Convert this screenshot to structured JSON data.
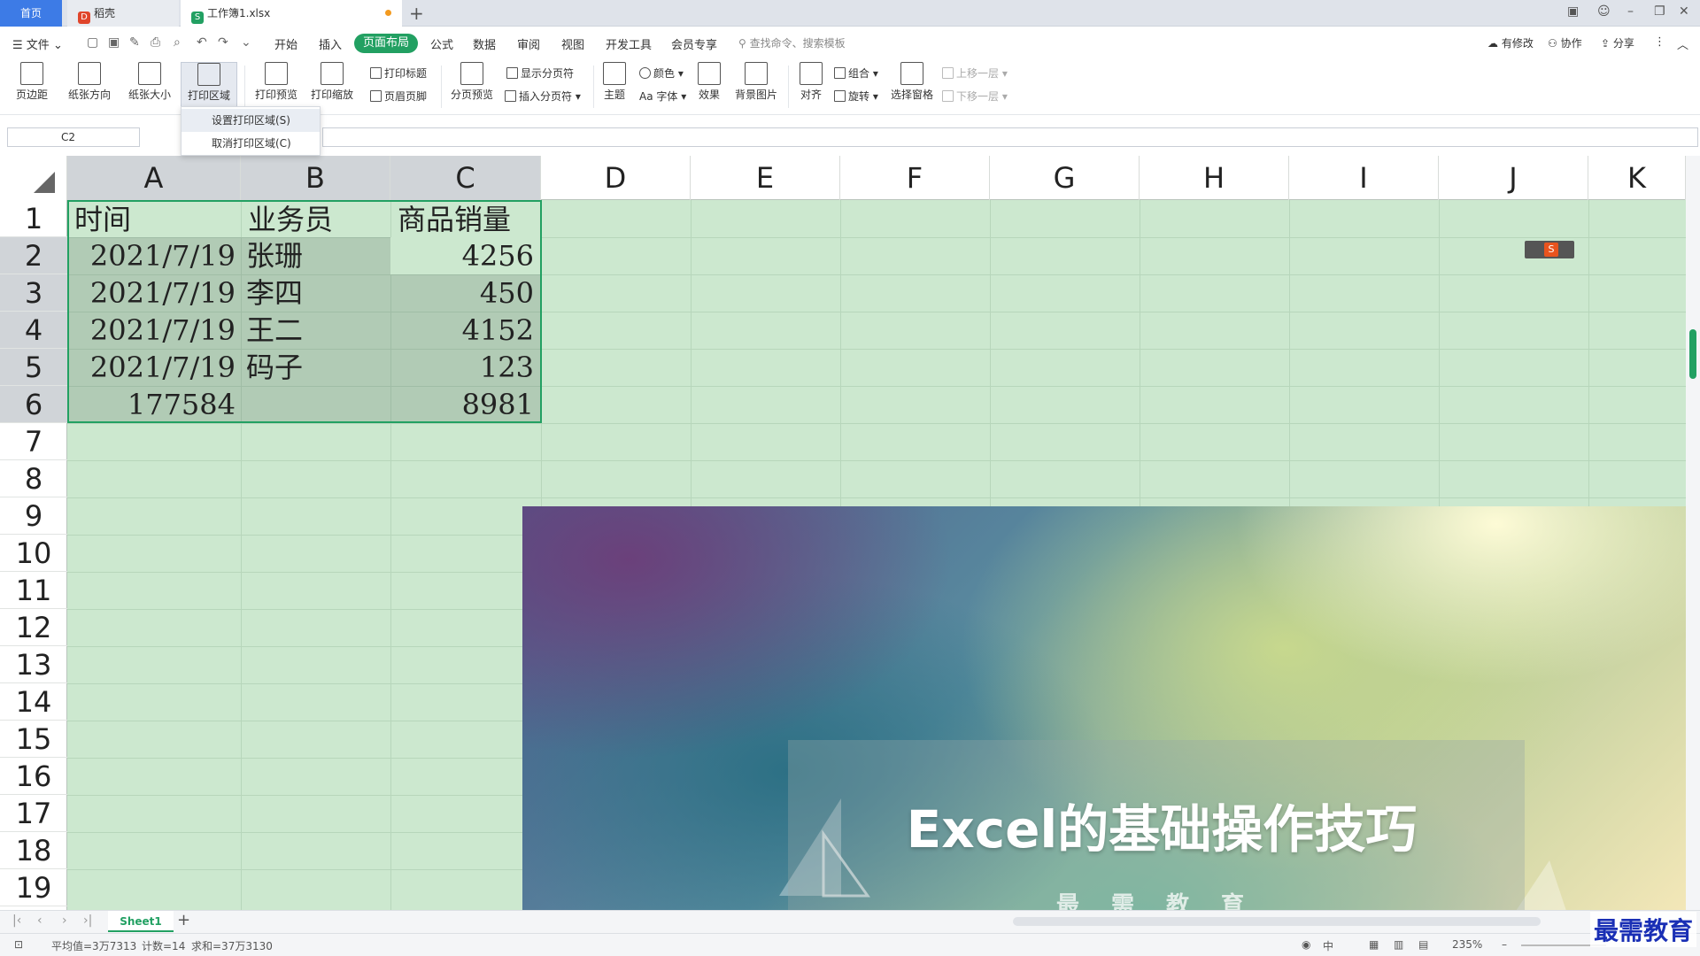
{
  "tabs": {
    "home": "首页",
    "draft": "稻壳",
    "workbook": "工作簿1.xlsx"
  },
  "menu": {
    "file": "文件",
    "items": [
      "开始",
      "插入",
      "页面布局",
      "公式",
      "数据",
      "审阅",
      "视图",
      "开发工具",
      "会员专享"
    ],
    "active": "页面布局",
    "search_placeholder": "查找命令、搜索模板",
    "right": [
      "有修改",
      "协作",
      "分享"
    ]
  },
  "ribbon": {
    "margins": "页边距",
    "orientation": "纸张方向",
    "size": "纸张大小",
    "print_area": "打印区域",
    "print_preview": "打印预览",
    "print_scale": "打印缩放",
    "print_titles": "打印标题",
    "header_footer": "页眉页脚",
    "page_break_preview": "分页预览",
    "show_page_breaks": "显示分页符",
    "insert_page_break": "插入分页符",
    "theme": "主题",
    "colors": "颜色",
    "fonts": "Aa 字体",
    "effects": "效果",
    "background": "背景图片",
    "align": "对齐",
    "group": "组合",
    "rotate": "旋转",
    "selection_pane": "选择窗格",
    "bring_forward": "上移一层",
    "send_backward": "下移一层"
  },
  "dropdown": {
    "set_area": "设置打印区域(S)",
    "clear_area": "取消打印区域(C)"
  },
  "namebox": "C2",
  "columns": [
    "A",
    "B",
    "C",
    "D",
    "E",
    "F",
    "G",
    "H",
    "I",
    "J",
    "K"
  ],
  "rows": [
    "1",
    "2",
    "3",
    "4",
    "5",
    "6",
    "7",
    "8",
    "9",
    "10",
    "11",
    "12",
    "13",
    "14",
    "15",
    "16",
    "17",
    "18",
    "19"
  ],
  "cells": {
    "header": [
      "时间",
      "业务员",
      "商品销量"
    ],
    "data": [
      [
        "2021/7/19",
        "张珊",
        "4256"
      ],
      [
        "2021/7/19",
        "李四",
        "450"
      ],
      [
        "2021/7/19",
        "王二",
        "4152"
      ],
      [
        "2021/7/19",
        "码子",
        "123"
      ],
      [
        "177584",
        "",
        "8981"
      ]
    ]
  },
  "banner": {
    "title": "Excel的基础操作技巧",
    "subtitle": "最需教育"
  },
  "sheet": {
    "name": "Sheet1"
  },
  "status": {
    "average": "平均值=3万7313",
    "count": "计数=14",
    "sum": "求和=37万3130",
    "input_mode": "中",
    "zoom": "235%"
  },
  "watermark": "最需教育",
  "colors": {
    "accent": "#22a062",
    "grid_bg": "#cce8cf",
    "home_tab": "#3d7be6"
  }
}
